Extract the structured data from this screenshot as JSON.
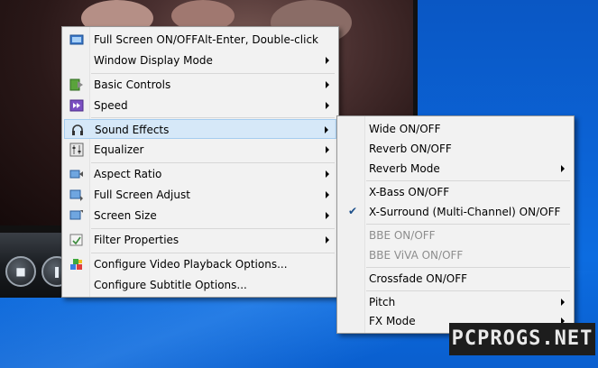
{
  "main_menu": {
    "items": [
      {
        "label": "Full Screen ON/OFF",
        "shortcut": "Alt-Enter, Double-click",
        "icon": "fullscreen-icon"
      },
      {
        "label": "Window Display Mode",
        "submenu": true
      },
      {
        "label": "Basic Controls",
        "submenu": true,
        "icon": "play-controls-icon"
      },
      {
        "label": "Speed",
        "submenu": true,
        "icon": "speed-icon"
      },
      {
        "label": "Sound Effects",
        "submenu": true,
        "icon": "headphones-icon",
        "highlighted": true
      },
      {
        "label": "Equalizer",
        "submenu": true,
        "icon": "equalizer-icon"
      },
      {
        "label": "Aspect Ratio",
        "submenu": true,
        "icon": "aspect-ratio-icon"
      },
      {
        "label": "Full Screen Adjust",
        "submenu": true,
        "icon": "screen-adjust-icon"
      },
      {
        "label": "Screen Size",
        "submenu": true,
        "icon": "screen-size-icon"
      },
      {
        "label": "Filter Properties",
        "submenu": true,
        "icon": "filter-icon"
      },
      {
        "label": "Configure Video Playback Options...",
        "icon": "config-icon"
      },
      {
        "label": "Configure Subtitle Options..."
      }
    ]
  },
  "sub_menu": {
    "items": [
      {
        "label": "Wide ON/OFF"
      },
      {
        "label": "Reverb ON/OFF"
      },
      {
        "label": "Reverb Mode",
        "submenu": true
      },
      {
        "label": "X-Bass ON/OFF"
      },
      {
        "label": "X-Surround (Multi-Channel) ON/OFF",
        "checked": true
      },
      {
        "label": "BBE ON/OFF",
        "disabled": true
      },
      {
        "label": "BBE ViVA ON/OFF",
        "disabled": true
      },
      {
        "label": "Crossfade ON/OFF"
      },
      {
        "label": "Pitch",
        "submenu": true
      },
      {
        "label": "FX Mode",
        "submenu": true
      }
    ],
    "check_glyph": "✔"
  },
  "watermark": {
    "text": "PCPROGS.NET"
  },
  "colors": {
    "desktop": "#0b62d4",
    "menu_bg": "#f2f2f2",
    "highlight": "#d6e8f8"
  }
}
